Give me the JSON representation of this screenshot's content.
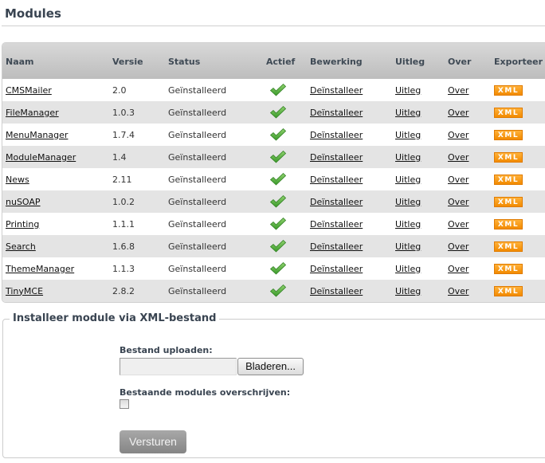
{
  "page": {
    "title": "Modules"
  },
  "table": {
    "headers": [
      "Naam",
      "Versie",
      "Status",
      "Actief",
      "Bewerking",
      "Uitleg",
      "Over",
      "Exporteer"
    ],
    "rows": [
      {
        "name": "CMSMailer",
        "version": "2.0",
        "status": "Geïnstalleerd",
        "active": true,
        "action": "Deïnstalleer",
        "help": "Uitleg",
        "about": "Over",
        "export": "XML"
      },
      {
        "name": "FileManager",
        "version": "1.0.3",
        "status": "Geïnstalleerd",
        "active": true,
        "action": "Deïnstalleer",
        "help": "Uitleg",
        "about": "Over",
        "export": "XML"
      },
      {
        "name": "MenuManager",
        "version": "1.7.4",
        "status": "Geïnstalleerd",
        "active": true,
        "action": "Deïnstalleer",
        "help": "Uitleg",
        "about": "Over",
        "export": "XML"
      },
      {
        "name": "ModuleManager",
        "version": "1.4",
        "status": "Geïnstalleerd",
        "active": true,
        "action": "Deïnstalleer",
        "help": "Uitleg",
        "about": "Over",
        "export": "XML"
      },
      {
        "name": "News",
        "version": "2.11",
        "status": "Geïnstalleerd",
        "active": true,
        "action": "Deïnstalleer",
        "help": "Uitleg",
        "about": "Over",
        "export": "XML"
      },
      {
        "name": "nuSOAP",
        "version": "1.0.2",
        "status": "Geïnstalleerd",
        "active": true,
        "action": "Deïnstalleer",
        "help": "Uitleg",
        "about": "Over",
        "export": "XML"
      },
      {
        "name": "Printing",
        "version": "1.1.1",
        "status": "Geïnstalleerd",
        "active": true,
        "action": "Deïnstalleer",
        "help": "Uitleg",
        "about": "Over",
        "export": "XML"
      },
      {
        "name": "Search",
        "version": "1.6.8",
        "status": "Geïnstalleerd",
        "active": true,
        "action": "Deïnstalleer",
        "help": "Uitleg",
        "about": "Over",
        "export": "XML"
      },
      {
        "name": "ThemeManager",
        "version": "1.1.3",
        "status": "Geïnstalleerd",
        "active": true,
        "action": "Deïnstalleer",
        "help": "Uitleg",
        "about": "Over",
        "export": "XML"
      },
      {
        "name": "TinyMCE",
        "version": "2.8.2",
        "status": "Geïnstalleerd",
        "active": true,
        "action": "Deïnstalleer",
        "help": "Uitleg",
        "about": "Over",
        "export": "XML"
      }
    ]
  },
  "install": {
    "legend": "Installeer module via XML-bestand",
    "upload_label": "Bestand uploaden:",
    "file_value": "",
    "browse_label": "Bladeren...",
    "overwrite_label": "Bestaande modules overschrijven:",
    "overwrite_checked": false,
    "submit_label": "Versturen"
  },
  "colors": {
    "accent_xml": "#f7940e",
    "check_green": "#4cae3a",
    "heading": "#394451"
  }
}
